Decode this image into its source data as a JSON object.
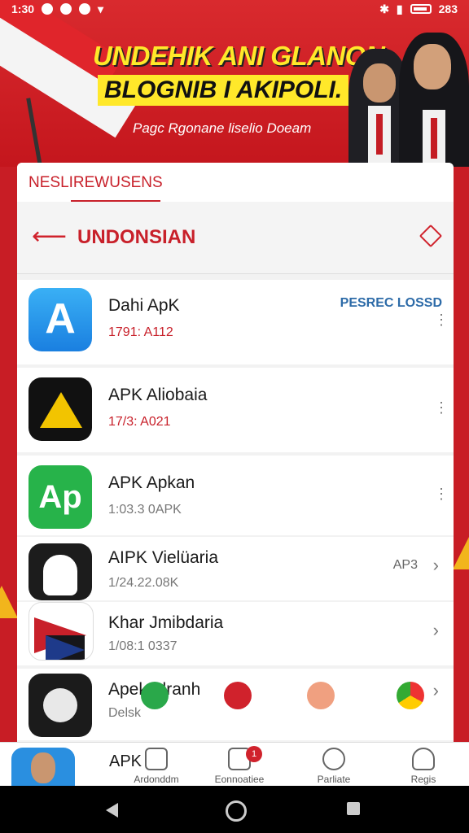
{
  "status_bar": {
    "time": "1:30",
    "battery": "283"
  },
  "banner": {
    "headline": "UNDEHIK ANI GLANON",
    "headline2": "BLOGNIB I AKIPOLI.",
    "subline": "Pagc Rgonane liselio Doeam"
  },
  "card": {
    "tab_label": "NESLIREWUSENS",
    "title": "UNDONSIAN"
  },
  "apps": [
    {
      "name": "Dahi ApK",
      "meta": "1791: A112",
      "meta_color": "#c8202a",
      "action": "PESREC LOSSD",
      "trailing": "dots"
    },
    {
      "name": "APK Aliobaia",
      "meta": "17/3: A021",
      "meta_color": "#c8202a",
      "trailing": "dots"
    },
    {
      "name": "APK Apkan",
      "meta": "1:03.3 0APK",
      "meta_color": "#777777",
      "trailing": "dots"
    },
    {
      "name": "AIPK Vielüaria",
      "meta": "1/24.22.08K",
      "meta_color": "#777777",
      "trailing_text": "AP3",
      "trailing": "chevron"
    },
    {
      "name": "Khar Jmibdaria",
      "meta": "1/08:1 0337",
      "meta_color": "#777777",
      "trailing": "chevron"
    },
    {
      "name": "Apek Alranh",
      "meta": "Delsk",
      "meta_color": "#777777",
      "trailing": "chevron"
    }
  ],
  "bottom_nav": {
    "first_label": "APK",
    "items": [
      {
        "label": "Ardonddm"
      },
      {
        "label": "Eonnoatiee",
        "badge": "1"
      },
      {
        "label": "Parliate"
      },
      {
        "label": "Regis"
      }
    ]
  }
}
